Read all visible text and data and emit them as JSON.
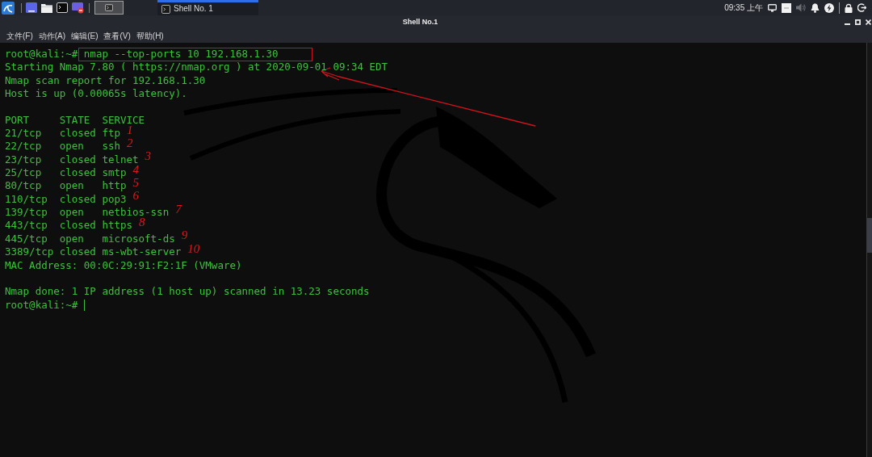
{
  "top_panel": {
    "taskbar": [
      {
        "label": "Shell No. 1",
        "selected": true
      }
    ],
    "clock": "09:35 上午"
  },
  "window": {
    "title": "Shell No.1",
    "menu": [
      "文件(F)",
      "动作(A)",
      "编辑(E)",
      "查看(V)",
      "帮助(H)"
    ]
  },
  "terminal": {
    "lines": [
      {
        "kind": "prompt",
        "prompt": "root@kali:~#",
        "command": "nmap --top-ports 10 192.168.1.30",
        "highlighted": true,
        "cursor": false
      },
      {
        "kind": "text",
        "text": "Starting Nmap 7.80 ( https://nmap.org ) at 2020-09-01 09:34 EDT"
      },
      {
        "kind": "text",
        "text": "Nmap scan report for 192.168.1.30"
      },
      {
        "kind": "text",
        "text": "Host is up (0.00065s latency)."
      },
      {
        "kind": "blank"
      },
      {
        "kind": "header",
        "columns": [
          "PORT",
          "STATE",
          "SERVICE"
        ]
      },
      {
        "kind": "port",
        "port": "21/tcp",
        "state": "closed",
        "service": "ftp",
        "note": "1"
      },
      {
        "kind": "port",
        "port": "22/tcp",
        "state": "open",
        "service": "ssh",
        "note": "2"
      },
      {
        "kind": "port",
        "port": "23/tcp",
        "state": "closed",
        "service": "telnet",
        "note": "3"
      },
      {
        "kind": "port",
        "port": "25/tcp",
        "state": "closed",
        "service": "smtp",
        "note": "4"
      },
      {
        "kind": "port",
        "port": "80/tcp",
        "state": "open",
        "service": "http",
        "note": "5"
      },
      {
        "kind": "port",
        "port": "110/tcp",
        "state": "closed",
        "service": "pop3",
        "note": "6"
      },
      {
        "kind": "port",
        "port": "139/tcp",
        "state": "open",
        "service": "netbios-ssn",
        "note": "7"
      },
      {
        "kind": "port",
        "port": "443/tcp",
        "state": "closed",
        "service": "https",
        "note": "8"
      },
      {
        "kind": "port",
        "port": "445/tcp",
        "state": "open",
        "service": "microsoft-ds",
        "note": "9"
      },
      {
        "kind": "port",
        "port": "3389/tcp",
        "state": "closed",
        "service": "ms-wbt-server",
        "note": "10"
      },
      {
        "kind": "text",
        "text": "MAC Address: 00:0C:29:91:F2:1F (VMware)"
      },
      {
        "kind": "blank"
      },
      {
        "kind": "text",
        "text": "Nmap done: 1 IP address (1 host up) scanned in 13.23 seconds"
      },
      {
        "kind": "prompt",
        "prompt": "root@kali:~#",
        "cursor": true
      }
    ]
  }
}
